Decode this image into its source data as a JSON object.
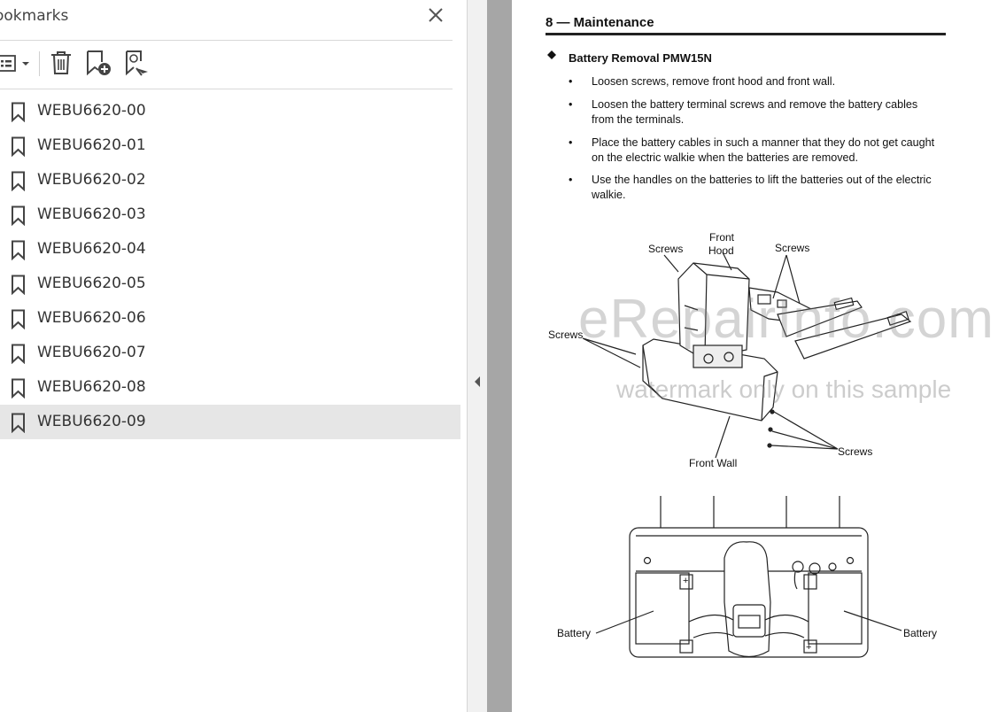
{
  "bookmarks_panel": {
    "title": "ookmarks",
    "items": [
      {
        "label": "WEBU6620-00"
      },
      {
        "label": "WEBU6620-01"
      },
      {
        "label": "WEBU6620-02"
      },
      {
        "label": "WEBU6620-03"
      },
      {
        "label": "WEBU6620-04"
      },
      {
        "label": "WEBU6620-05"
      },
      {
        "label": "WEBU6620-06"
      },
      {
        "label": "WEBU6620-07"
      },
      {
        "label": "WEBU6620-08"
      },
      {
        "label": "WEBU6620-09",
        "selected": true
      }
    ],
    "toolbar_icons": [
      "list-options-icon",
      "trash-icon",
      "new-bookmark-icon",
      "find-bookmark-icon"
    ],
    "close_icon": "close-icon"
  },
  "document": {
    "heading": "8 — Maintenance",
    "section_title": "Battery Removal PMW15N",
    "steps": [
      {
        "bullet": "•",
        "text": "Loosen screws, remove front hood and front wall."
      },
      {
        "bullet": "•",
        "text": "Loosen the battery terminal screws and remove the battery cables from the terminals."
      },
      {
        "bullet": "•",
        "text": "Place the battery cables in such a manner that they do not get caught on the electric walkie when the batteries are removed."
      },
      {
        "bullet": "•",
        "text": "Use the handles on the batteries to lift the batteries out of the electric walkie."
      }
    ],
    "figure1_labels": {
      "screws_top_left": "Screws",
      "front_hood_line1": "Front",
      "front_hood_line2": "Hood",
      "screws_top_right": "Screws",
      "screws_left": "Screws",
      "screws_right": "Screws",
      "front_wall": "Front Wall"
    },
    "figure2_labels": {
      "battery_left": "Battery",
      "battery_right": "Battery",
      "plus_left": "+",
      "plus_right": "+"
    },
    "watermark": {
      "line1": "eRepairInfo.com",
      "line2": "watermark only on this sample"
    }
  },
  "colors": {
    "selected_bg": "#e6e6e6",
    "gray_gutter": "#a6a6a6"
  }
}
